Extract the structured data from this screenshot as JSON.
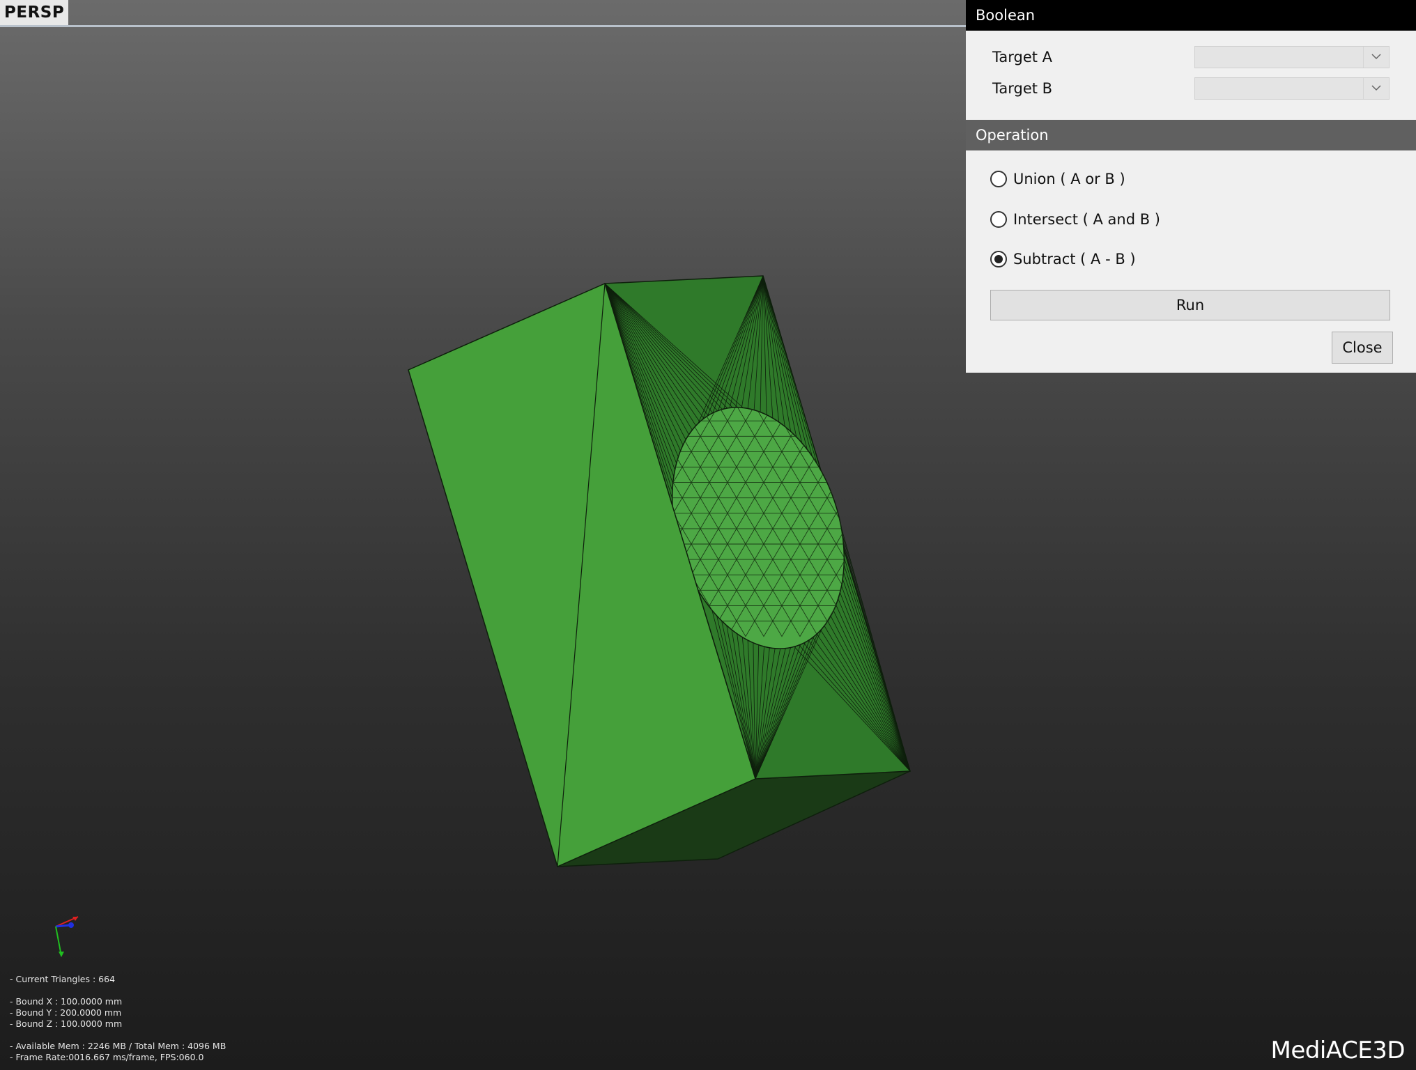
{
  "viewport": {
    "view_mode": "PERSP",
    "stats": {
      "current_triangles": "- Current Triangles : 664",
      "bound_x": "- Bound X : 100.0000 mm",
      "bound_y": "- Bound Y : 200.0000 mm",
      "bound_z": "- Bound Z : 100.0000 mm",
      "memory": "- Available Mem : 2246 MB / Total Mem : 4096 MB",
      "frame_rate": "- Frame Rate:0016.667 ms/frame, FPS:060.0"
    },
    "logo": "MediACE3D",
    "model_colors": {
      "light_face": "#45a03a",
      "mid_face": "#2f7a2a",
      "dark_face": "#1a3a16",
      "sphere": "#4da845",
      "edge": "#0e1f0c"
    }
  },
  "boolean_panel": {
    "title": "Boolean",
    "target_a_label": "Target A",
    "target_a_value": "",
    "target_b_label": "Target B",
    "target_b_value": "",
    "operation_header": "Operation",
    "operations": [
      {
        "label": "Union ( A or B )",
        "checked": false
      },
      {
        "label": "Intersect ( A and B )",
        "checked": false
      },
      {
        "label": "Subtract ( A - B )",
        "checked": true
      }
    ],
    "run_label": "Run",
    "close_label": "Close"
  }
}
